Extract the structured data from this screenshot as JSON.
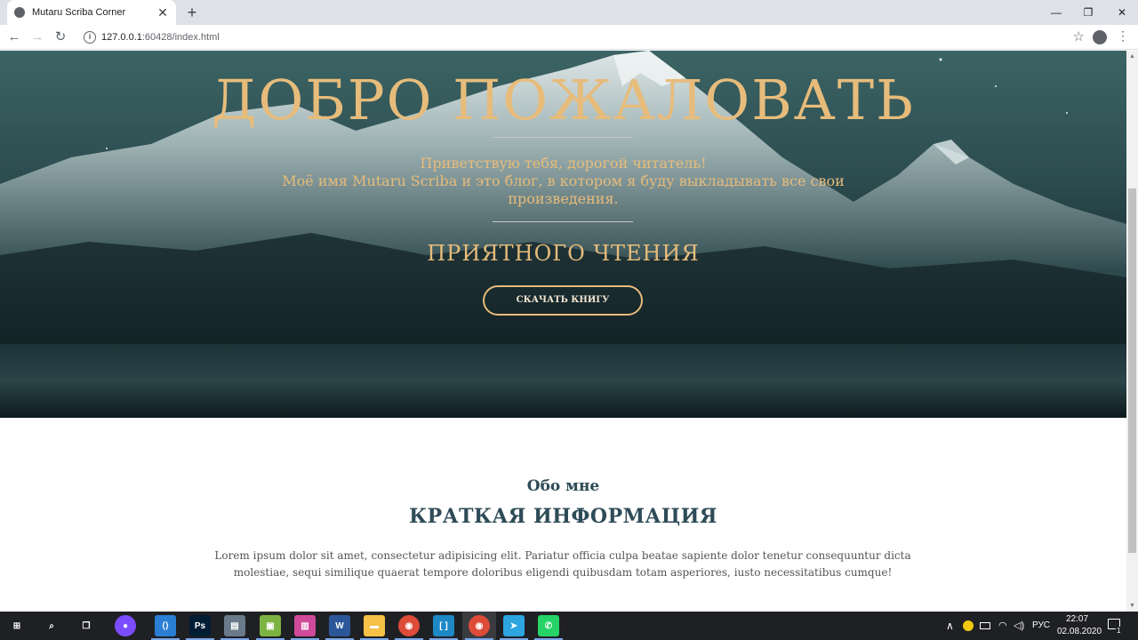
{
  "browser": {
    "tab_title": "Mutaru Scriba Corner",
    "tab_close": "✕",
    "new_tab": "+",
    "url_host": "127.0.0.1",
    "url_rest": ":60428/index.html",
    "window_controls": {
      "minimize": "—",
      "maximize": "❐",
      "close": "✕"
    },
    "nav": {
      "back": "←",
      "forward": "→",
      "reload": "↻"
    },
    "star": "☆",
    "menu": "⋮"
  },
  "hero": {
    "title": "ДОБРО ПОЖАЛОВАТЬ",
    "greeting": "Приветствую тебя, дорогой читатель!",
    "intro": "Моё имя Mutaru Scriba и это блог, в котором я буду выкладывать все свои произведения.",
    "enjoy": "ПРИЯТНОГО ЧТЕНИЯ",
    "download_button": "СКАЧАТЬ КНИГУ"
  },
  "about": {
    "subtitle": "Обо мне",
    "title": "КРАТКАЯ ИНФОРМАЦИЯ",
    "text": "Lorem ipsum dolor sit amet, consectetur adipisicing elit. Pariatur officia culpa beatae sapiente dolor tenetur consequuntur dicta molestiae, sequi similique quaerat tempore doloribus eligendi quibusdam totam asperiores, iusto necessitatibus cumque!"
  },
  "taskbar": {
    "apps": [
      {
        "name": "start",
        "label": "⊞",
        "color": "#1f2023"
      },
      {
        "name": "search",
        "label": "⌕",
        "color": "#1f2023"
      },
      {
        "name": "task-view",
        "label": "❐",
        "color": "#1f2023"
      },
      {
        "name": "alice",
        "label": "●",
        "color": "#7b4dff"
      },
      {
        "name": "vscode",
        "label": "⟨⟩",
        "color": "#2a7fd4"
      },
      {
        "name": "photoshop",
        "label": "Ps",
        "color": "#001d34"
      },
      {
        "name": "explorer-drive",
        "label": "▤",
        "color": "#6b7a8a"
      },
      {
        "name": "android-studio",
        "label": "▣",
        "color": "#7cb342"
      },
      {
        "name": "paint",
        "label": "▥",
        "color": "#d04a9a"
      },
      {
        "name": "word",
        "label": "W",
        "color": "#2b579a"
      },
      {
        "name": "file-explorer",
        "label": "▬",
        "color": "#f5c146"
      },
      {
        "name": "chrome",
        "label": "◉",
        "color": "#dd4b39"
      },
      {
        "name": "brackets",
        "label": "[ ]",
        "color": "#1e88c7"
      },
      {
        "name": "chrome-active",
        "label": "◉",
        "color": "#dd4b39"
      },
      {
        "name": "telegram",
        "label": "➤",
        "color": "#2ca5e0"
      },
      {
        "name": "whatsapp",
        "label": "✆",
        "color": "#25d366"
      }
    ],
    "tray_chevron": "∧",
    "language": "РУС",
    "time": "22:07",
    "date": "02.08.2020",
    "notification_count": "1"
  }
}
